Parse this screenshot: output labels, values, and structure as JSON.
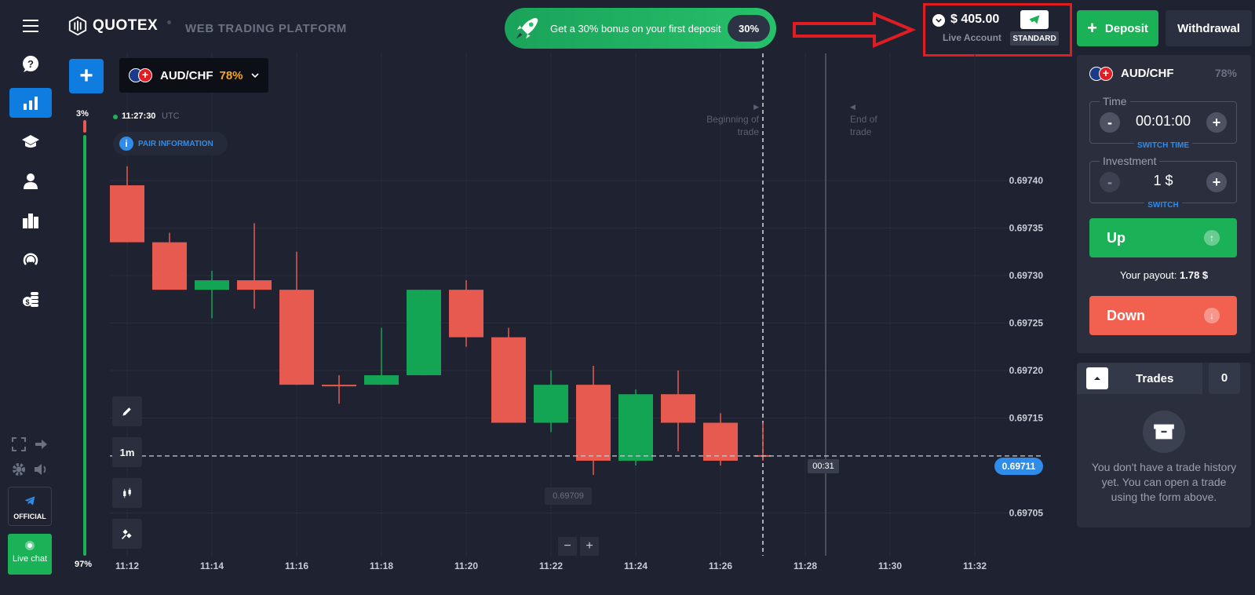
{
  "brand": {
    "logo_text": "QUOTEX",
    "platform": "WEB TRADING PLATFORM"
  },
  "bonus": {
    "text": "Get a 30% bonus on your first deposit",
    "pill": "30%"
  },
  "account": {
    "balance": "$ 405.00",
    "type": "Live Account",
    "tier": "STANDARD"
  },
  "header_buttons": {
    "deposit": "Deposit",
    "withdrawal": "Withdrawal"
  },
  "chart_header": {
    "pair": "AUD/CHF",
    "payout": "78%",
    "time": "11:27:30",
    "tz": "UTC",
    "pair_info": "PAIR INFORMATION"
  },
  "sentiment": {
    "top": "3%",
    "bottom": "97%"
  },
  "timeframe": "1m",
  "trade_markers": {
    "begin": "Beginning of trade",
    "end": "End of trade"
  },
  "price_tags": {
    "current": "0.69711",
    "countdown": "00:31",
    "low": "0.69709"
  },
  "chart_data": {
    "type": "candlestick",
    "x": [
      "11:12",
      "11:13",
      "11:14",
      "11:15",
      "11:16",
      "11:17",
      "11:18",
      "11:19",
      "11:20",
      "11:21",
      "11:22",
      "11:23",
      "11:24",
      "11:25",
      "11:26",
      "11:27"
    ],
    "ohlc": [
      [
        0.697395,
        0.697415,
        0.697335,
        0.697335
      ],
      [
        0.697335,
        0.697345,
        0.697285,
        0.697285
      ],
      [
        0.697285,
        0.697305,
        0.697255,
        0.697295
      ],
      [
        0.697295,
        0.697355,
        0.697265,
        0.697285
      ],
      [
        0.697285,
        0.697325,
        0.697185,
        0.697185
      ],
      [
        0.697185,
        0.697195,
        0.697165,
        0.697185
      ],
      [
        0.697185,
        0.697245,
        0.697185,
        0.697195
      ],
      [
        0.697195,
        0.697285,
        0.697195,
        0.697285
      ],
      [
        0.697285,
        0.697295,
        0.697225,
        0.697235
      ],
      [
        0.697235,
        0.697245,
        0.697145,
        0.697145
      ],
      [
        0.697145,
        0.6972,
        0.697135,
        0.697185
      ],
      [
        0.697185,
        0.697205,
        0.69709,
        0.697105
      ],
      [
        0.697105,
        0.69718,
        0.6971,
        0.697175
      ],
      [
        0.697175,
        0.6972,
        0.697115,
        0.697145
      ],
      [
        0.697145,
        0.697155,
        0.6971,
        0.697105
      ],
      [
        0.69711,
        0.697145,
        0.697105,
        0.69711
      ]
    ],
    "y_ticks": [
      "0.69740",
      "0.69735",
      "0.69730",
      "0.69725",
      "0.69720",
      "0.69715",
      "0.69705"
    ],
    "x_ticks": [
      "11:12",
      "11:14",
      "11:16",
      "11:18",
      "11:20",
      "11:22",
      "11:24",
      "11:26",
      "11:28",
      "11:30",
      "11:32"
    ],
    "colors": {
      "up": "#13a454",
      "down": "#e65a4f"
    }
  },
  "order_panel": {
    "pair": "AUD/CHF",
    "payout": "78%",
    "time_label": "Time",
    "time_value": "00:01:00",
    "switch_time": "SWITCH TIME",
    "investment_label": "Investment",
    "investment_value": "1 $",
    "switch": "SWITCH",
    "up": "Up",
    "down": "Down",
    "payout_label": "Your payout:",
    "payout_value": "1.78 $"
  },
  "trades": {
    "title": "Trades",
    "count": "0",
    "empty_text": "You don't have a trade history yet. You can open a trade using the form above."
  },
  "sidebar": {
    "official": "OFFICIAL",
    "live_chat": "Live chat"
  },
  "zoom": {
    "minus": "−",
    "plus": "+"
  }
}
